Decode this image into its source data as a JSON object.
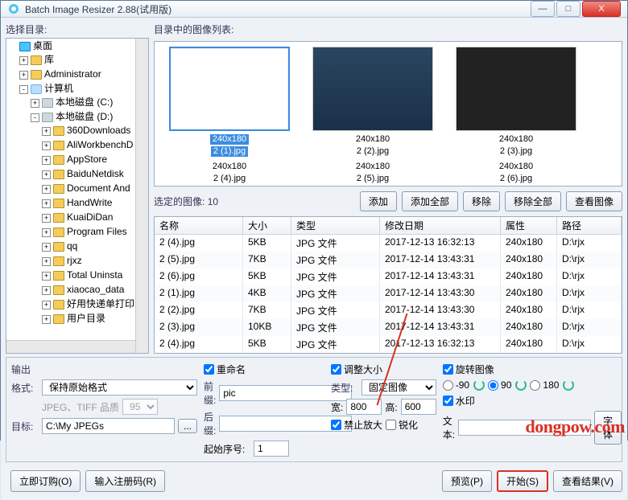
{
  "window": {
    "title": "Batch Image Resizer 2.88(试用版)"
  },
  "win_btns": {
    "min": "—",
    "max": "□",
    "close": "X"
  },
  "tree": {
    "title": "选择目录:",
    "desktop": "桌面",
    "lib": "库",
    "admin": "Administrator",
    "computer": "计算机",
    "drive_c": "本地磁盘 (C:)",
    "drive_d": "本地磁盘 (D:)",
    "d_items": [
      "360Downloads",
      "AliWorkbenchD",
      "AppStore",
      "BaiduNetdisk",
      "Document And",
      "HandWrite",
      "KuaiDiDan",
      "Program Files",
      "qq",
      "rjxz",
      "Total Uninsta",
      "xiaocao_data",
      "好用快递单打印",
      "用户目录"
    ]
  },
  "thumbs": {
    "title": "目录中的图像列表:",
    "items": [
      {
        "dim": "240x180",
        "name": "2 (1).jpg",
        "sel": true
      },
      {
        "dim": "240x180",
        "name": "2 (2).jpg",
        "sel": false
      },
      {
        "dim": "240x180",
        "name": "2 (3).jpg",
        "sel": false
      },
      {
        "dim": "240x180",
        "name": "2 (4).jpg",
        "sel": false
      },
      {
        "dim": "240x180",
        "name": "2 (5).jpg",
        "sel": false
      },
      {
        "dim": "240x180",
        "name": "2 (6).jpg",
        "sel": false
      }
    ]
  },
  "toolbar": {
    "selected_label": "选定的图像:",
    "selected_count": "10",
    "add": "添加",
    "add_all": "添加全部",
    "remove": "移除",
    "remove_all": "移除全部",
    "view": "查看图像"
  },
  "table": {
    "cols": {
      "name": "名称",
      "size": "大小",
      "type": "类型",
      "date": "修改日期",
      "attr": "属性",
      "path": "路径"
    },
    "rows": [
      {
        "name": "2 (4).jpg",
        "size": "5KB",
        "type": "JPG 文件",
        "date": "2017-12-13 16:32:13",
        "attr": "240x180",
        "path": "D:\\rjx"
      },
      {
        "name": "2 (5).jpg",
        "size": "7KB",
        "type": "JPG 文件",
        "date": "2017-12-14 13:43:31",
        "attr": "240x180",
        "path": "D:\\rjx"
      },
      {
        "name": "2 (6).jpg",
        "size": "5KB",
        "type": "JPG 文件",
        "date": "2017-12-14 13:43:31",
        "attr": "240x180",
        "path": "D:\\rjx"
      },
      {
        "name": "2 (1).jpg",
        "size": "4KB",
        "type": "JPG 文件",
        "date": "2017-12-14 13:43:30",
        "attr": "240x180",
        "path": "D:\\rjx"
      },
      {
        "name": "2 (2).jpg",
        "size": "7KB",
        "type": "JPG 文件",
        "date": "2017-12-14 13:43:30",
        "attr": "240x180",
        "path": "D:\\rjx"
      },
      {
        "name": "2 (3).jpg",
        "size": "10KB",
        "type": "JPG 文件",
        "date": "2017-12-14 13:43:31",
        "attr": "240x180",
        "path": "D:\\rjx"
      },
      {
        "name": "2 (4).jpg",
        "size": "5KB",
        "type": "JPG 文件",
        "date": "2017-12-13 16:32:13",
        "attr": "240x180",
        "path": "D:\\rjx"
      }
    ]
  },
  "output": {
    "title": "输出",
    "format_label": "格式:",
    "format_value": "保持原始格式",
    "quality_label": "JPEG、TIFF 品质",
    "quality_value": "95",
    "dest_label": "目标:",
    "dest_value": "C:\\My JPEGs",
    "browse": "...",
    "rename": {
      "chk": "重命名",
      "prefix_label": "前缀:",
      "prefix": "pic",
      "suffix_label": "后缀:",
      "suffix": "",
      "start_label": "起始序号:",
      "start": "1"
    },
    "resize": {
      "chk": "调整大小",
      "type_label": "类型:",
      "type_value": "固定图像",
      "w_label": "宽:",
      "w": "800",
      "h_label": "高:",
      "h": "600",
      "nozoom": "禁止放大",
      "sharpen": "锐化"
    },
    "rotate": {
      "chk": "旋转图像",
      "m90": "-90",
      "p90": "90",
      "r180": "180",
      "watermark": "水印",
      "text_label": "文本:",
      "font": "字体"
    }
  },
  "actions": {
    "order": "立即订购(O)",
    "reg": "输入注册码(R)",
    "preview": "预览(P)",
    "start": "开始(S)",
    "result": "查看结果(V)"
  },
  "watermark_text": "dongpow.com"
}
